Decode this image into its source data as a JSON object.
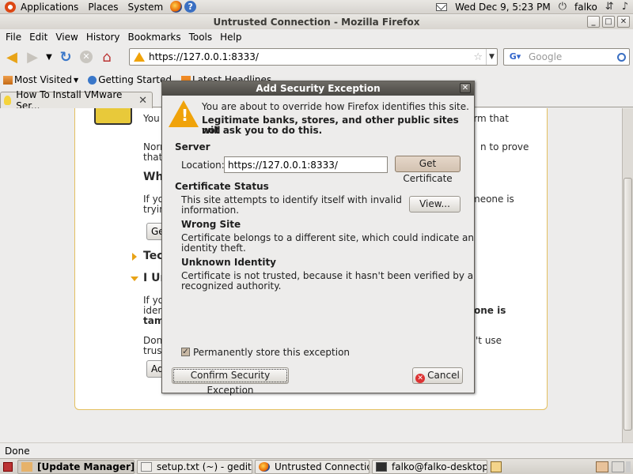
{
  "top_panel": {
    "applications": "Applications",
    "places": "Places",
    "system": "System",
    "clock": "Wed Dec  9,  5:23 PM",
    "user": "falko"
  },
  "window": {
    "title": "Untrusted Connection - Mozilla Firefox",
    "minimize": "_",
    "maximize": "□",
    "close": "✕"
  },
  "menubar": {
    "file": "File",
    "edit": "Edit",
    "view": "View",
    "history": "History",
    "bookmarks": "Bookmarks",
    "tools": "Tools",
    "help": "Help"
  },
  "nav": {
    "url": "https://127.0.0.1:8333/",
    "search_placeholder": "Google"
  },
  "bookmarks": {
    "most_visited": "Most Visited",
    "getting_started": "Getting Started",
    "latest_headlines": "Latest Headlines"
  },
  "tabs": [
    {
      "label": "How To Install VMware Ser..."
    }
  ],
  "page": {
    "p1a": "You h",
    "p1b": "irm that",
    "p2a": "Norm",
    "p2b": "n to prove",
    "p2c": "that",
    "h_what": "Wha",
    "p3a": "If you",
    "p3b": "meone is",
    "p3c": "tryin",
    "btn_get": "Ge",
    "h_tech": "Tec",
    "h_under": "I Un",
    "p4a": "If you",
    "p4b": "ident",
    "p4c": "one is",
    "p4d": "tam",
    "p5a": "Don'",
    "p5b": "'t use",
    "p5c": "trust",
    "btn_add": "Ad"
  },
  "dialog": {
    "title": "Add Security Exception",
    "intro": "You are about to override how Firefox identifies this site.",
    "warning_line1": "Legitimate banks, stores, and other public sites will",
    "warning_line2": "not ask you to do this.",
    "server_heading": "Server",
    "location_label": "Location:",
    "location_value": "https://127.0.0.1:8333/",
    "get_certificate": "Get Certificate",
    "cert_status_heading": "Certificate Status",
    "status_line1": "This site attempts to identify itself with invalid",
    "status_line2": "information.",
    "view_button": "View...",
    "wrong_site_heading": "Wrong Site",
    "wrong_site_line1": "Certificate belongs to a different site, which could indicate an",
    "wrong_site_line2": "identity theft.",
    "unknown_heading": "Unknown Identity",
    "unknown_line1": "Certificate is not trusted, because it hasn't been verified by a",
    "unknown_line2": "recognized authority.",
    "store_checkbox": "Permanently store this exception",
    "confirm_button": "Confirm Security Exception",
    "cancel_button": "Cancel"
  },
  "statusbar": {
    "text": "Done"
  },
  "taskbar": {
    "items": [
      {
        "label": "[Update Manager]"
      },
      {
        "label": "setup.txt (~) - gedit"
      },
      {
        "label": "Untrusted Connectio..."
      },
      {
        "label": "falko@falko-desktop:..."
      }
    ]
  },
  "colors": {
    "accent_warning": "#f0a30a",
    "dialog_title_bg": "#4b4945",
    "ubuntu_orange": "#dd4814"
  }
}
